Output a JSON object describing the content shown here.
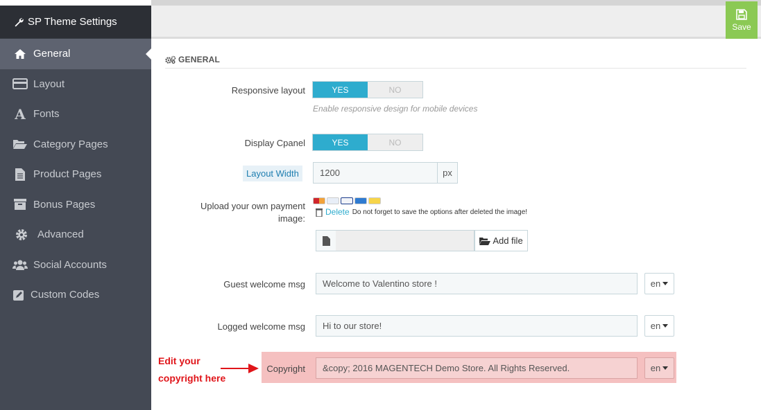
{
  "app": {
    "title": "SP Theme Settings",
    "save_label": "Save"
  },
  "sidebar": {
    "items": [
      {
        "label": "General",
        "icon": "home-icon",
        "active": true
      },
      {
        "label": "Layout",
        "icon": "layout-icon",
        "active": false
      },
      {
        "label": "Fonts",
        "icon": "font-icon",
        "active": false
      },
      {
        "label": "Category Pages",
        "icon": "folder-open-icon",
        "active": false
      },
      {
        "label": "Product Pages",
        "icon": "file-text-icon",
        "active": false
      },
      {
        "label": "Bonus Pages",
        "icon": "archive-icon",
        "active": false
      },
      {
        "label": "Advanced",
        "icon": "gear-icon",
        "active": false
      },
      {
        "label": "Social Accounts",
        "icon": "users-icon",
        "active": false
      },
      {
        "label": "Custom Codes",
        "icon": "edit-icon",
        "active": false
      }
    ]
  },
  "panel": {
    "title": "GENERAL"
  },
  "form": {
    "responsive": {
      "label": "Responsive layout",
      "yes": "YES",
      "no": "NO",
      "help": "Enable responsive design for mobile devices"
    },
    "cpanel": {
      "label": "Display Cpanel",
      "yes": "YES",
      "no": "NO"
    },
    "layout_width": {
      "label": "Layout Width",
      "value": "1200",
      "unit": "px"
    },
    "payment": {
      "label_line1": "Upload your own payment",
      "label_line2": "image:",
      "delete_label": "Delete",
      "delete_note": "Do not forget to save the options after deleted the image!",
      "add_file_label": "Add file"
    },
    "guest_welcome": {
      "label": "Guest welcome msg",
      "value": "Welcome to Valentino store !",
      "lang": "en"
    },
    "logged_welcome": {
      "label": "Logged welcome msg",
      "value": "Hi to our store!",
      "lang": "en"
    },
    "copyright": {
      "label": "Copyright",
      "value": "&copy; 2016 MAGENTECH Demo Store. All Rights Reserved.",
      "lang": "en"
    }
  },
  "annotation": {
    "line1": "Edit your",
    "line2": "copyright here",
    "color": "#e0151a"
  },
  "colors": {
    "accent": "#2eacce",
    "save": "#8bc954",
    "sidebar": "#444954"
  }
}
